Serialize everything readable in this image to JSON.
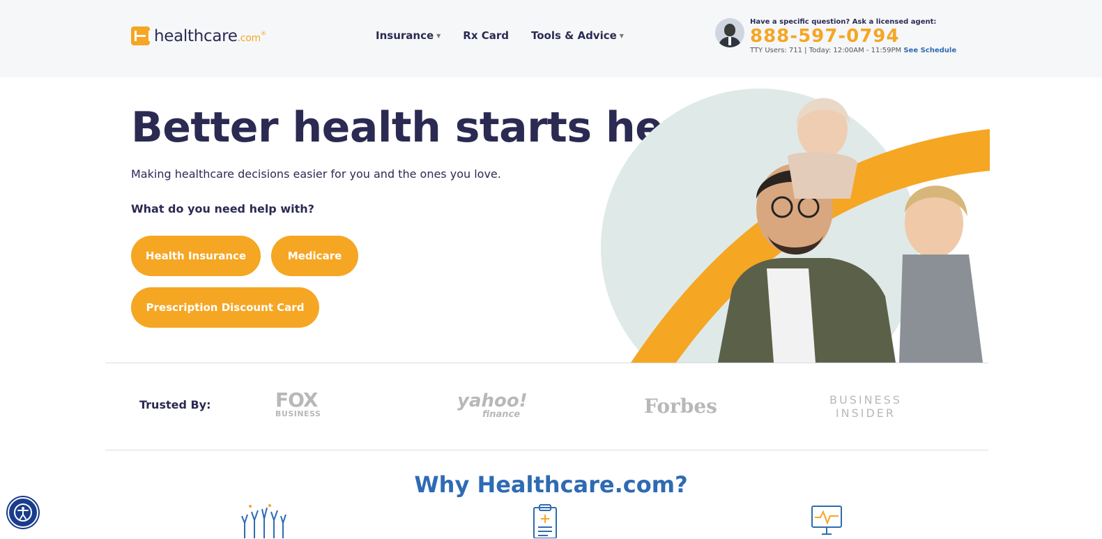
{
  "header": {
    "logo": {
      "text": "healthcare",
      "suffix": ".com",
      "reg": "®"
    },
    "nav": [
      {
        "label": "Insurance",
        "has_caret": true
      },
      {
        "label": "Rx Card",
        "has_caret": false
      },
      {
        "label": "Tools & Advice",
        "has_caret": true
      }
    ],
    "agent": {
      "question": "Have a specific question? Ask a licensed agent:",
      "phone": "888-597-0794",
      "tty": "TTY Users: 711 | Today: 12:00AM - 11:59PM",
      "schedule_link": "See Schedule"
    }
  },
  "hero": {
    "title": "Better health starts here.",
    "subtitle": "Making healthcare decisions easier for you and the ones you love.",
    "question": "What do you need help with?",
    "buttons": [
      "Health Insurance",
      "Medicare",
      "Prescription Discount Card"
    ]
  },
  "trusted": {
    "label": "Trusted By:",
    "brands": {
      "fox_top": "FOX",
      "fox_bottom": "BUSINESS",
      "yahoo_top": "yahoo!",
      "yahoo_bottom": "finance",
      "forbes": "Forbes",
      "bi_top": "BUSINESS",
      "bi_bottom": "INSIDER"
    }
  },
  "why": {
    "title": "Why Healthcare.com?"
  },
  "colors": {
    "brand_orange": "#f5a623",
    "navy": "#2b2a52",
    "link_blue": "#2e6bb3",
    "header_bg": "#f6f7f9"
  },
  "icons": [
    "phone-agent-icon",
    "hands-raised-icon",
    "clipboard-medical-icon",
    "monitor-heartbeat-icon",
    "accessibility-icon"
  ]
}
